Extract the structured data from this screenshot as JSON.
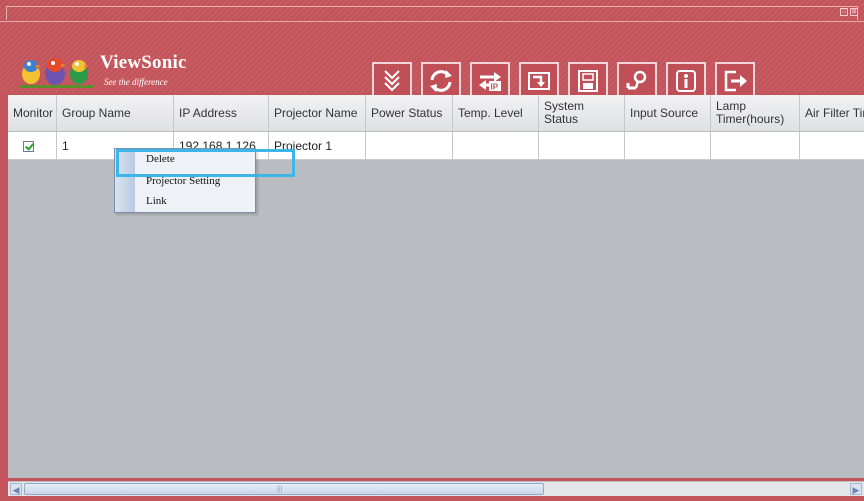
{
  "window": {
    "min_icon": "□",
    "close_icon": "⊠"
  },
  "brand": {
    "name": "ViewSonic",
    "tagline": "See the difference"
  },
  "toolbar": {
    "buttons": [
      {
        "icon": "auto-search-icon"
      },
      {
        "icon": "refresh-icon"
      },
      {
        "icon": "ip-swap-icon"
      },
      {
        "icon": "import-icon"
      },
      {
        "icon": "save-icon"
      },
      {
        "icon": "settings-key-icon"
      },
      {
        "icon": "info-icon"
      },
      {
        "icon": "exit-icon"
      }
    ]
  },
  "table": {
    "columns": [
      "Monitor",
      "Group Name",
      "IP Address",
      "Projector Name",
      "Power Status",
      "Temp. Level",
      "System Status",
      "Input Source",
      "Lamp Timer(hours)",
      "Air Filter Timer (hours)"
    ],
    "rows": [
      {
        "monitor_checked": true,
        "group": "1",
        "ip": "192.168.1.126",
        "name": "Projector 1",
        "power": "",
        "temp": "",
        "system": "",
        "input": "",
        "lamp": "",
        "filter": ""
      }
    ]
  },
  "context_menu": {
    "items": [
      "Delete",
      "Projector Setting",
      "Link"
    ]
  },
  "colors": {
    "frame": "#c4555c",
    "highlight": "#3db5e8",
    "grid_bg": "#b9bcc1"
  }
}
